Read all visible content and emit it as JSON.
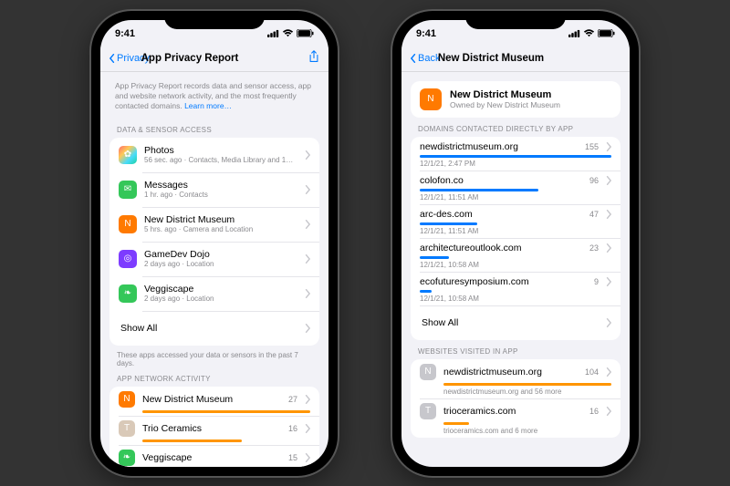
{
  "status": {
    "time": "9:41"
  },
  "phone1": {
    "back": "Privacy",
    "title": "App Privacy Report",
    "intro_a": "App Privacy Report records data and sensor access, app and website network activity, and the most frequently contacted domains. ",
    "intro_link": "Learn more…",
    "sec1_header": "DATA & SENSOR ACCESS",
    "apps": [
      {
        "name": "Photos",
        "sub": "56 sec. ago · Contacts, Media Library and 1…",
        "icon": "ic-photos",
        "glyph": "✿"
      },
      {
        "name": "Messages",
        "sub": "1 hr. ago · Contacts",
        "icon": "ic-messages",
        "glyph": "✉"
      },
      {
        "name": "New District Museum",
        "sub": "5 hrs. ago · Camera and Location",
        "icon": "ic-ndm",
        "glyph": "N"
      },
      {
        "name": "GameDev Dojo",
        "sub": "2 days ago · Location",
        "icon": "ic-gamedev",
        "glyph": "◎"
      },
      {
        "name": "Veggiscape",
        "sub": "2 days ago · Location",
        "icon": "ic-veggi",
        "glyph": "❧"
      }
    ],
    "show_all": "Show All",
    "sec1_footer": "These apps accessed your data or sensors in the past 7 days.",
    "sec2_header": "APP NETWORK ACTIVITY",
    "network": [
      {
        "name": "New District Museum",
        "count": 27,
        "icon": "ic-ndm",
        "glyph": "N"
      },
      {
        "name": "Trio Ceramics",
        "count": 16,
        "icon": "ic-trio",
        "glyph": "T"
      },
      {
        "name": "Veggiscape",
        "count": 15,
        "icon": "ic-veggi",
        "glyph": "❧"
      }
    ],
    "net_max": 27
  },
  "phone2": {
    "back": "Back",
    "title": "New District Museum",
    "app_name": "New District Museum",
    "app_sub": "Owned by New District Museum",
    "sec1_header": "DOMAINS CONTACTED DIRECTLY BY APP",
    "domains": [
      {
        "name": "newdistrictmuseum.org",
        "count": 155,
        "time": "12/1/21, 2:47 PM"
      },
      {
        "name": "colofon.co",
        "count": 96,
        "time": "12/1/21, 11:51 AM"
      },
      {
        "name": "arc-des.com",
        "count": 47,
        "time": "12/1/21, 11:51 AM"
      },
      {
        "name": "architectureoutlook.com",
        "count": 23,
        "time": "12/1/21, 10:58 AM"
      },
      {
        "name": "ecofuturesymposium.com",
        "count": 9,
        "time": "12/1/21, 10:58 AM"
      }
    ],
    "domain_max": 155,
    "show_all": "Show All",
    "sec2_header": "WEBSITES VISITED IN APP",
    "websites": [
      {
        "name": "newdistrictmuseum.org",
        "count": 104,
        "sub": "newdistrictmuseum.org and 56 more",
        "glyph": "N"
      },
      {
        "name": "trioceramics.com",
        "count": 16,
        "sub": "trioceramics.com and 6 more",
        "glyph": "T"
      }
    ],
    "web_max": 104
  },
  "colors": {
    "orange": "#ff9500",
    "blue": "#007aff"
  }
}
